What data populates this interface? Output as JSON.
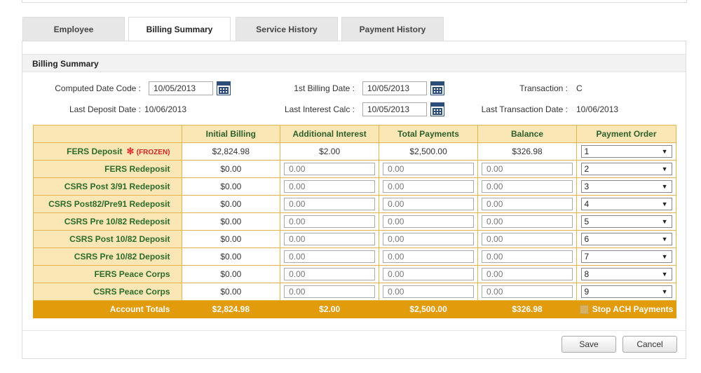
{
  "tabs": [
    {
      "label": "Employee"
    },
    {
      "label": "Billing Summary"
    },
    {
      "label": "Service History"
    },
    {
      "label": "Payment History"
    }
  ],
  "section": {
    "title": "Billing Summary"
  },
  "fields": {
    "computed_date_code_label": "Computed Date Code :",
    "computed_date_code_value": "10/05/2013",
    "first_billing_date_label": "1st Billing Date :",
    "first_billing_date_value": "10/05/2013",
    "transaction_label": "Transaction :",
    "transaction_value": "C",
    "last_deposit_date_label": "Last Deposit Date :",
    "last_deposit_date_value": "10/06/2013",
    "last_interest_calc_label": "Last Interest Calc :",
    "last_interest_calc_value": "10/05/2013",
    "last_transaction_date_label": "Last Transaction Date :",
    "last_transaction_date_value": "10/06/2013"
  },
  "table": {
    "headers": [
      "",
      "Initial Billing",
      "Additional Interest",
      "Total Payments",
      "Balance",
      "Payment Order"
    ],
    "frozen_label": "(FROZEN)",
    "rows": [
      {
        "label": "FERS Deposit",
        "initial": "$2,824.98",
        "interest": "$2.00",
        "payments": "$2,500.00",
        "balance": "$326.98",
        "order": "1"
      },
      {
        "label": "FERS Redeposit",
        "initial": "$0.00",
        "interest": "0.00",
        "payments": "0.00",
        "balance": "0.00",
        "order": "2"
      },
      {
        "label": "CSRS Post 3/91 Redeposit",
        "initial": "$0.00",
        "interest": "0.00",
        "payments": "0.00",
        "balance": "0.00",
        "order": "3"
      },
      {
        "label": "CSRS Post82/Pre91 Redeposit",
        "initial": "$0.00",
        "interest": "0.00",
        "payments": "0.00",
        "balance": "0.00",
        "order": "4"
      },
      {
        "label": "CSRS Pre 10/82 Redeposit",
        "initial": "$0.00",
        "interest": "0.00",
        "payments": "0.00",
        "balance": "0.00",
        "order": "5"
      },
      {
        "label": "CSRS Post 10/82 Deposit",
        "initial": "$0.00",
        "interest": "0.00",
        "payments": "0.00",
        "balance": "0.00",
        "order": "6"
      },
      {
        "label": "CSRS Pre 10/82 Deposit",
        "initial": "$0.00",
        "interest": "0.00",
        "payments": "0.00",
        "balance": "0.00",
        "order": "7"
      },
      {
        "label": "FERS Peace Corps",
        "initial": "$0.00",
        "interest": "0.00",
        "payments": "0.00",
        "balance": "0.00",
        "order": "8"
      },
      {
        "label": "CSRS Peace Corps",
        "initial": "$0.00",
        "interest": "0.00",
        "payments": "0.00",
        "balance": "0.00",
        "order": "9"
      }
    ],
    "totals": {
      "label": "Account Totals",
      "initial": "$2,824.98",
      "interest": "$2.00",
      "payments": "$2,500.00",
      "balance": "$326.98",
      "stop_ach_label": "Stop ACH Payments"
    }
  },
  "buttons": {
    "save": "Save",
    "cancel": "Cancel"
  },
  "colors": {
    "header_bg": "#fbe6b5",
    "totals_bg": "#e29b0a",
    "label_green": "#2b6b2b",
    "frozen_red": "#d02525"
  }
}
